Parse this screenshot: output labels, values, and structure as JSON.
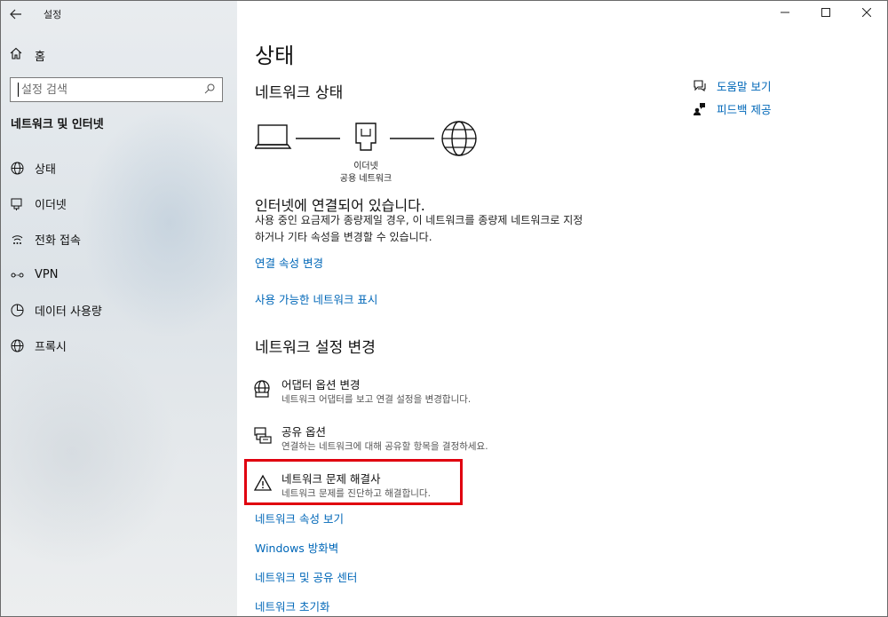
{
  "app": {
    "title": "설정"
  },
  "sidebar": {
    "home_label": "홈",
    "search_placeholder": "설정 검색",
    "section_title": "네트워크 및 인터넷",
    "items": [
      {
        "label": "상태",
        "icon": "status-globe-icon"
      },
      {
        "label": "이더넷",
        "icon": "ethernet-icon"
      },
      {
        "label": "전화 접속",
        "icon": "dialup-icon"
      },
      {
        "label": "VPN",
        "icon": "vpn-icon"
      },
      {
        "label": "데이터 사용량",
        "icon": "data-usage-icon"
      },
      {
        "label": "프록시",
        "icon": "proxy-globe-icon"
      }
    ]
  },
  "main": {
    "page_title": "상태",
    "network_status_heading": "네트워크 상태",
    "diagram": {
      "adapter_name": "이더넷",
      "network_name": "공용 네트워크"
    },
    "connected_title": "인터넷에 연결되어 있습니다.",
    "connected_desc": "사용 중인 요금제가 종량제일 경우, 이 네트워크를 종량제 네트워크로 지정하거나 기타 속성을 변경할 수 있습니다.",
    "links_top": [
      "연결 속성 변경",
      "사용 가능한 네트워크 표시"
    ],
    "change_settings_heading": "네트워크 설정 변경",
    "options": [
      {
        "title": "어댑터 옵션 변경",
        "subtitle": "네트워크 어댑터를 보고 연결 설정을 변경합니다."
      },
      {
        "title": "공유 옵션",
        "subtitle": "연결하는 네트워크에 대해 공유할 항목을 결정하세요."
      },
      {
        "title": "네트워크 문제 해결사",
        "subtitle": "네트워크 문제를 진단하고 해결합니다."
      }
    ],
    "links_bottom": [
      "네트워크 속성 보기",
      "Windows 방화벽",
      "네트워크 및 공유 센터",
      "네트워크 초기화"
    ]
  },
  "aside": {
    "help_label": "도움말 보기",
    "feedback_label": "피드백 제공"
  },
  "colors": {
    "link": "#0067b8",
    "highlight": "#e0000f"
  }
}
